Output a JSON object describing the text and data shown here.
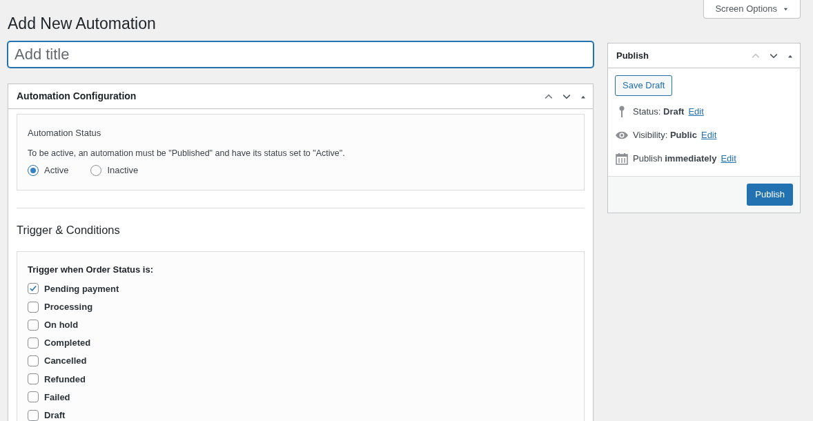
{
  "screen_options": {
    "label": "Screen Options"
  },
  "page_title": "Add New Automation",
  "title_field": {
    "placeholder": "Add title"
  },
  "config_box": {
    "title": "Automation Configuration",
    "status_panel": {
      "heading": "Automation Status",
      "description": "To be active, an automation must be \"Published\" and have its status set to \"Active\".",
      "options": [
        {
          "label": "Active",
          "selected": true
        },
        {
          "label": "Inactive",
          "selected": false
        }
      ]
    },
    "trigger_heading": "Trigger & Conditions",
    "trigger_panel": {
      "label": "Trigger when Order Status is:",
      "statuses": [
        {
          "label": "Pending payment",
          "checked": true
        },
        {
          "label": "Processing",
          "checked": false
        },
        {
          "label": "On hold",
          "checked": false
        },
        {
          "label": "Completed",
          "checked": false
        },
        {
          "label": "Cancelled",
          "checked": false
        },
        {
          "label": "Refunded",
          "checked": false
        },
        {
          "label": "Failed",
          "checked": false
        },
        {
          "label": "Draft",
          "checked": false
        }
      ]
    }
  },
  "publish_box": {
    "title": "Publish",
    "save_draft": "Save Draft",
    "meta": [
      {
        "kind": "status",
        "text": "Status: **Draft**",
        "link": "Edit"
      },
      {
        "kind": "visibility",
        "text": "Visibility: **Public**",
        "link": "Edit"
      },
      {
        "kind": "schedule",
        "text": "Publish **immediately**",
        "link": "Edit"
      }
    ],
    "publish_button": "Publish"
  }
}
